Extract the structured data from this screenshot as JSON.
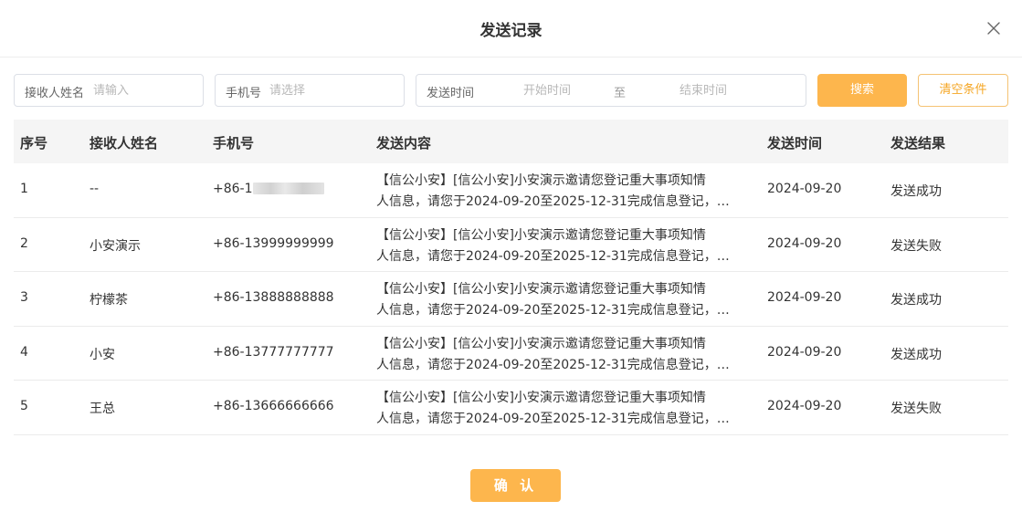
{
  "dialog": {
    "title": "发送记录",
    "close_icon": "close-icon"
  },
  "filters": {
    "name": {
      "label": "接收人姓名",
      "placeholder": "请输入",
      "value": ""
    },
    "phone": {
      "label": "手机号",
      "placeholder": "请选择",
      "value": ""
    },
    "time": {
      "label": "发送时间",
      "start_placeholder": "开始时间",
      "separator": "至",
      "end_placeholder": "结束时间"
    }
  },
  "buttons": {
    "search": "搜索",
    "clear": "清空条件",
    "confirm": "确 认"
  },
  "table": {
    "headers": [
      "序号",
      "接收人姓名",
      "手机号",
      "发送内容",
      "发送时间",
      "发送结果"
    ],
    "rows": [
      {
        "index": "1",
        "name": "--",
        "phone_prefix": "+86-1",
        "phone": "",
        "content_line1": "【信公小安】[信公小安]小安演示邀请您登记重大事项知情",
        "content_line2": "人信息，请您于2024-09-20至2025-12-31完成信息登记，…",
        "time": "2024-09-20",
        "result": "发送成功"
      },
      {
        "index": "2",
        "name": "小安演示",
        "phone": "+86-13999999999",
        "content_line1": "【信公小安】[信公小安]小安演示邀请您登记重大事项知情",
        "content_line2": "人信息，请您于2024-09-20至2025-12-31完成信息登记，…",
        "time": "2024-09-20",
        "result": "发送失败"
      },
      {
        "index": "3",
        "name": "柠檬茶",
        "phone": "+86-13888888888",
        "content_line1": "【信公小安】[信公小安]小安演示邀请您登记重大事项知情",
        "content_line2": "人信息，请您于2024-09-20至2025-12-31完成信息登记，…",
        "time": "2024-09-20",
        "result": "发送成功"
      },
      {
        "index": "4",
        "name": "小安",
        "phone": "+86-13777777777",
        "content_line1": "【信公小安】[信公小安]小安演示邀请您登记重大事项知情",
        "content_line2": "人信息，请您于2024-09-20至2025-12-31完成信息登记，…",
        "time": "2024-09-20",
        "result": "发送成功"
      },
      {
        "index": "5",
        "name": "王总",
        "phone": "+86-13666666666",
        "content_line1": "【信公小安】[信公小安]小安演示邀请您登记重大事项知情",
        "content_line2": "人信息，请您于2024-09-20至2025-12-31完成信息登记，…",
        "time": "2024-09-20",
        "result": "发送失败"
      }
    ]
  },
  "colors": {
    "accent": "#fdb64d",
    "accent_text": "#f5a623",
    "header_bg": "#f5f5f5",
    "border": "#dcdfe6"
  }
}
